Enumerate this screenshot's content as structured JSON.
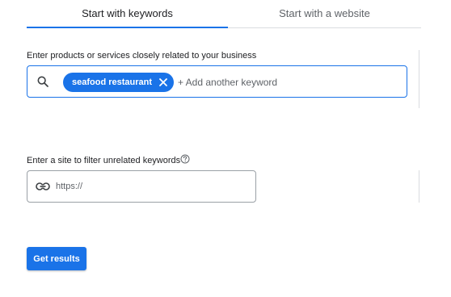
{
  "tabs": [
    {
      "label": "Start with keywords",
      "active": true
    },
    {
      "label": "Start with a website",
      "active": false
    }
  ],
  "keywords_section": {
    "label": "Enter products or services closely related to your business",
    "chips": [
      {
        "label": "seafood restaurant"
      }
    ],
    "input_value": "",
    "input_placeholder": "+ Add another keyword",
    "icon": "search-icon"
  },
  "site_section": {
    "label": "Enter a site to filter unrelated keywords",
    "help_icon": "help-icon",
    "input_value": "",
    "input_placeholder": "https://",
    "icon": "link-icon"
  },
  "submit_button": {
    "label": "Get results"
  },
  "colors": {
    "accent": "#1a73e8",
    "text": "#202124",
    "muted": "#5f6368",
    "divider": "#dadce0"
  }
}
